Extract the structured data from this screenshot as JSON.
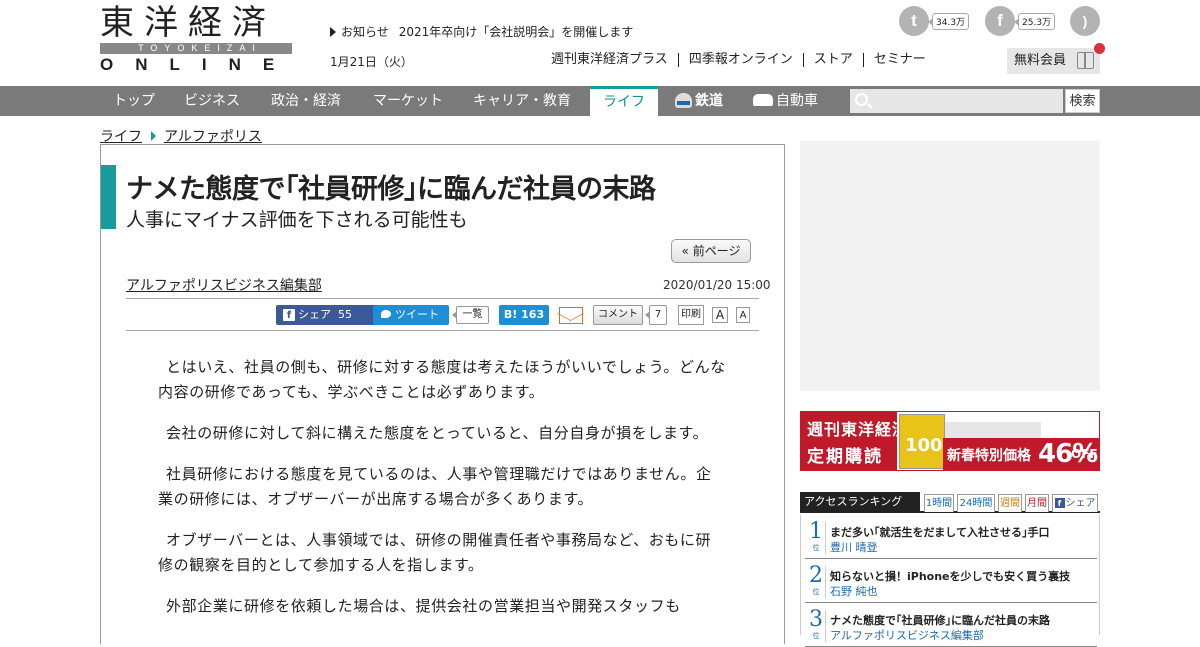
{
  "header": {
    "logo_kanji": "東洋経済",
    "logo_latin": "TOYOKEIZAI",
    "logo_online": "ONLINE",
    "notice_label": "お知らせ",
    "notice_text": "2021年卒向け「会社説明会」を開催します",
    "date": "1月21日（火）",
    "social": [
      {
        "icon": "twitter-icon",
        "count": "34.3万"
      },
      {
        "icon": "facebook-icon",
        "count": "25.3万"
      },
      {
        "icon": "rss-icon",
        "count": ""
      }
    ],
    "top_links": [
      "週刊東洋経済プラス",
      "四季報オンライン",
      "ストア",
      "セミナー"
    ],
    "member_label": "無料会員"
  },
  "nav": {
    "items": [
      "トップ",
      "ビジネス",
      "政治・経済",
      "マーケット",
      "キャリア・教育",
      "ライフ",
      "鉄道",
      "自動車"
    ],
    "active": "ライフ",
    "search_placeholder": "",
    "search_button": "検索"
  },
  "breadcrumb": [
    "ライフ",
    "アルファポリス"
  ],
  "article": {
    "title": "ナメた態度で｢社員研修｣に臨んだ社員の末路",
    "subtitle": "人事にマイナス評価を下される可能性も",
    "prev_page": "« 前ページ",
    "author": "アルファポリスビジネス編集部",
    "published": "2020/01/20 15:00",
    "share": {
      "facebook_label": "シェア",
      "facebook_count": "55",
      "tweet_label": "ツイート",
      "list_label": "一覧",
      "hatena_label": "B!",
      "hatena_count": "163",
      "comment_label": "コメント",
      "comment_count": "7",
      "print_label": "印刷",
      "font_large": "A",
      "font_small": "A"
    },
    "paragraphs": [
      "とはいえ、社員の側も、研修に対する態度は考えたほうがいいでしょう。どんな内容の研修であっても、学ぶべきことは必ずあります。",
      "会社の研修に対して斜に構えた態度をとっていると、自分自身が損をします。",
      "社員研修における態度を見ているのは、人事や管理職だけではありません。企業の研修には、オブザーバーが出席する場合が多くあります。",
      "オブザーバーとは、人事領域では、研修の開催責任者や事務局など、おもに研修の観察を目的として参加する人を指します。",
      "外部企業に研修を依頼した場合は、提供会社の営業担当や開発スタッフも"
    ]
  },
  "banner": {
    "title_line1": "週刊東洋経済",
    "title_line2": "定期購読",
    "badge_number": "100",
    "offer_text": "新春特別価格",
    "offer_percent": "46%",
    "offer_suffix": "OFF"
  },
  "ranking": {
    "title": "アクセスランキング",
    "tabs": [
      "1時間",
      "24時間",
      "週間",
      "月間",
      "シェア"
    ],
    "rank_suffix": "位",
    "items": [
      {
        "rank": "1",
        "title": "まだ多い｢就活生をだまして入社させる｣手口",
        "author": "豊川 晴登"
      },
      {
        "rank": "2",
        "title": "知らないと損！iPhoneを少しでも安く買う裏技",
        "author": "石野 純也"
      },
      {
        "rank": "3",
        "title": "ナメた態度で｢社員研修｣に臨んだ社員の末路",
        "author": "アルファポリスビジネス編集部"
      }
    ]
  }
}
